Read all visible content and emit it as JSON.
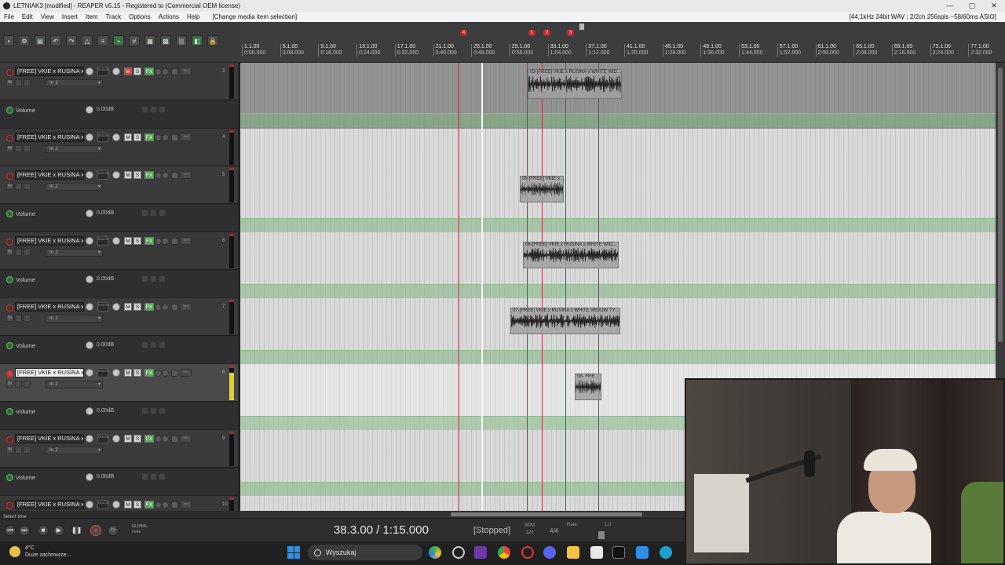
{
  "window": {
    "title": "LETNIAK3 [modified] - REAPER v5.15 - Registered to  (Commercial OEM license)",
    "controls": [
      "—",
      "▢",
      "✕"
    ]
  },
  "menu": {
    "items": [
      "File",
      "Edit",
      "View",
      "Insert",
      "Item",
      "Track",
      "Options",
      "Actions",
      "Help",
      "[Change media item selection]"
    ],
    "status": "[44.1kHz 24bit WAV : 2/2ch 256spls ~58/60ms ASIO]"
  },
  "ruler": {
    "ticks": [
      {
        "bar": "1.1.00",
        "time": "0:00.000"
      },
      {
        "bar": "5.1.00",
        "time": "0:08.000"
      },
      {
        "bar": "9.1.00",
        "time": "0:16.000"
      },
      {
        "bar": "13.1.00",
        "time": "0:24.000"
      },
      {
        "bar": "17.1.00",
        "time": "0:32.000"
      },
      {
        "bar": "21.1.00",
        "time": "0:40.000"
      },
      {
        "bar": "25.1.00",
        "time": "0:48.000"
      },
      {
        "bar": "29.1.00",
        "time": "0:56.000"
      },
      {
        "bar": "33.1.00",
        "time": "1:04.000"
      },
      {
        "bar": "37.1.00",
        "time": "1:12.000"
      },
      {
        "bar": "41.1.00",
        "time": "1:20.000"
      },
      {
        "bar": "45.1.00",
        "time": "1:28.000"
      },
      {
        "bar": "49.1.00",
        "time": "1:36.000"
      },
      {
        "bar": "53.1.00",
        "time": "1:44.000"
      },
      {
        "bar": "57.1.00",
        "time": "1:52.000"
      },
      {
        "bar": "61.1.00",
        "time": "2:00.000"
      },
      {
        "bar": "65.1.00",
        "time": "2:08.000"
      },
      {
        "bar": "69.1.00",
        "time": "2:16.000"
      },
      {
        "bar": "73.1.00",
        "time": "2:24.000"
      },
      {
        "bar": "77.1.00",
        "time": "2:32.000"
      }
    ],
    "markers": [
      "4",
      "1",
      "2",
      "3"
    ]
  },
  "tracks": [
    {
      "name": "[FREE] VKIE x RUSINA x W",
      "input": "In 2",
      "num": "3",
      "mute_on": true,
      "selected": false
    },
    {
      "name": "[FREE] VKIE x RUSINA x W",
      "input": "In 2",
      "num": "4",
      "mute_on": false,
      "selected": false
    },
    {
      "name": "[FREE] VKIE x RUSINA x W",
      "input": "In 2",
      "num": "5",
      "mute_on": false,
      "selected": false
    },
    {
      "name": "[FREE] VKIE x RUSINA x W",
      "input": "In 2",
      "num": "6",
      "mute_on": false,
      "selected": false
    },
    {
      "name": "[FREE] VKIE x RUSINA x W",
      "input": "In 2",
      "num": "7",
      "mute_on": false,
      "selected": false
    },
    {
      "name": "[FREE] VKIE x RUSINA x W",
      "input": "In 2",
      "num": "8",
      "mute_on": false,
      "selected": true
    },
    {
      "name": "[FREE] VKIE x RUSINA x W",
      "input": "In 2",
      "num": "9",
      "mute_on": false,
      "selected": false
    },
    {
      "name": "[FREE] VKIE x RUSINA x W",
      "input": "In 2",
      "num": "10",
      "mute_on": false,
      "selected": false
    }
  ],
  "labels": {
    "mute": "M",
    "solo": "S",
    "fx": "FX",
    "route": "ROUTE",
    "trim": "trim",
    "in": "IN",
    "volume": "Volume",
    "volume_value": "0.00dB"
  },
  "items": [
    {
      "name": "03-[FREE] VKIE x RUSINA x WHITE WID..."
    },
    {
      "name": "05-[FREE] VKIE x ..."
    },
    {
      "name": "06-[FREE] VKIE x RUSINA x WHITE WID..."
    },
    {
      "name": "07-[FREE] VKIE x RUSINA x WHITE WIDOW TY..."
    },
    {
      "name": "08- FRE..."
    }
  ],
  "transport": {
    "selection": "Select time",
    "position": "38.3.00 / 1:15.000",
    "state": "[Stopped]",
    "bpm_label": "BPM",
    "bpm": "120",
    "signature": "4/4",
    "rate_label": "Rate:",
    "rate": "1.0",
    "global_label": "GLOBAL",
    "global_value": "none"
  },
  "taskbar": {
    "temperature": "4°C",
    "weather": "Duże zachmurze...",
    "search": "Wyszukaj"
  },
  "colors": {
    "marker": "#c8262f",
    "fx_on": "#4fae4f",
    "mute_on": "#d33333",
    "envelope": "#8fb98f"
  }
}
